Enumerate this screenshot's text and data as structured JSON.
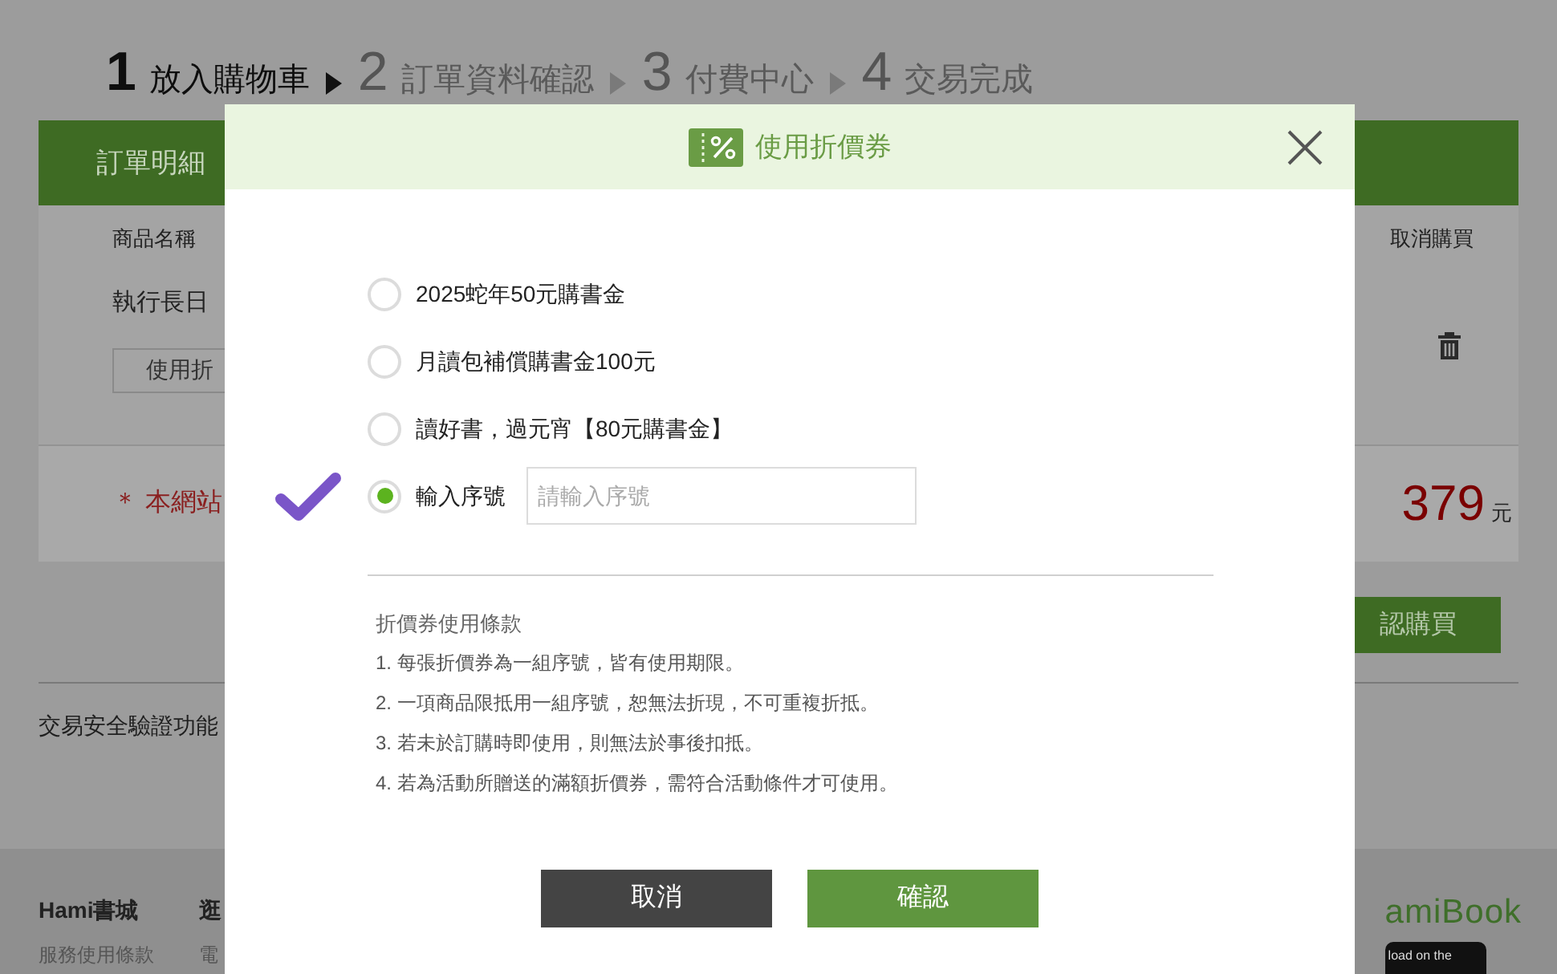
{
  "steps": [
    {
      "number": "1",
      "label": "放入購物車",
      "selected": true
    },
    {
      "number": "2",
      "label": "訂單資料確認",
      "selected": false
    },
    {
      "number": "3",
      "label": "付費中心",
      "selected": false
    },
    {
      "number": "4",
      "label": "交易完成",
      "selected": false
    }
  ],
  "order": {
    "title": "訂單明細",
    "columns": [
      "商品名稱",
      "取消購買"
    ],
    "item": {
      "name": "執行長日",
      "coupon_button": "使用折"
    },
    "notice": "＊ 本網站",
    "total": "379",
    "currency": "元",
    "checkout_button": "認購買",
    "security_text": "交易安全驗證功能"
  },
  "footer": {
    "columns": [
      {
        "heading": "Hami書城",
        "link": "服務使用條款"
      },
      {
        "heading": "逛",
        "link": "電"
      }
    ],
    "brand": "amiBook",
    "app_badge": "load on the"
  },
  "coupon_dialog": {
    "title": "使用折價券",
    "options": [
      {
        "kind": "coupon",
        "label": "2025蛇年50元購書金",
        "selected": false
      },
      {
        "kind": "coupon",
        "label": "月讀包補償購書金100元",
        "selected": false
      },
      {
        "kind": "coupon",
        "label": "讀好書，過元宵【80元購書金】",
        "selected": false
      },
      {
        "kind": "serial",
        "label": "輸入序號",
        "placeholder": "請輸入序號",
        "selected": true
      }
    ],
    "terms_title": "折價券使用條款",
    "terms": [
      "1. 每張折價券為一組序號，皆有使用期限。",
      "2. 一項商品限抵用一組序號，恕無法折現，不可重複折抵。",
      "3. 若未於訂購時即使用，則無法於事後扣抵。",
      "4. 若為活動所贈送的滿額折價券，需符合活動條件才可使用。"
    ],
    "buttons": [
      {
        "kind": "cancel",
        "label": "取消"
      },
      {
        "kind": "confirm",
        "label": "確認"
      }
    ]
  }
}
